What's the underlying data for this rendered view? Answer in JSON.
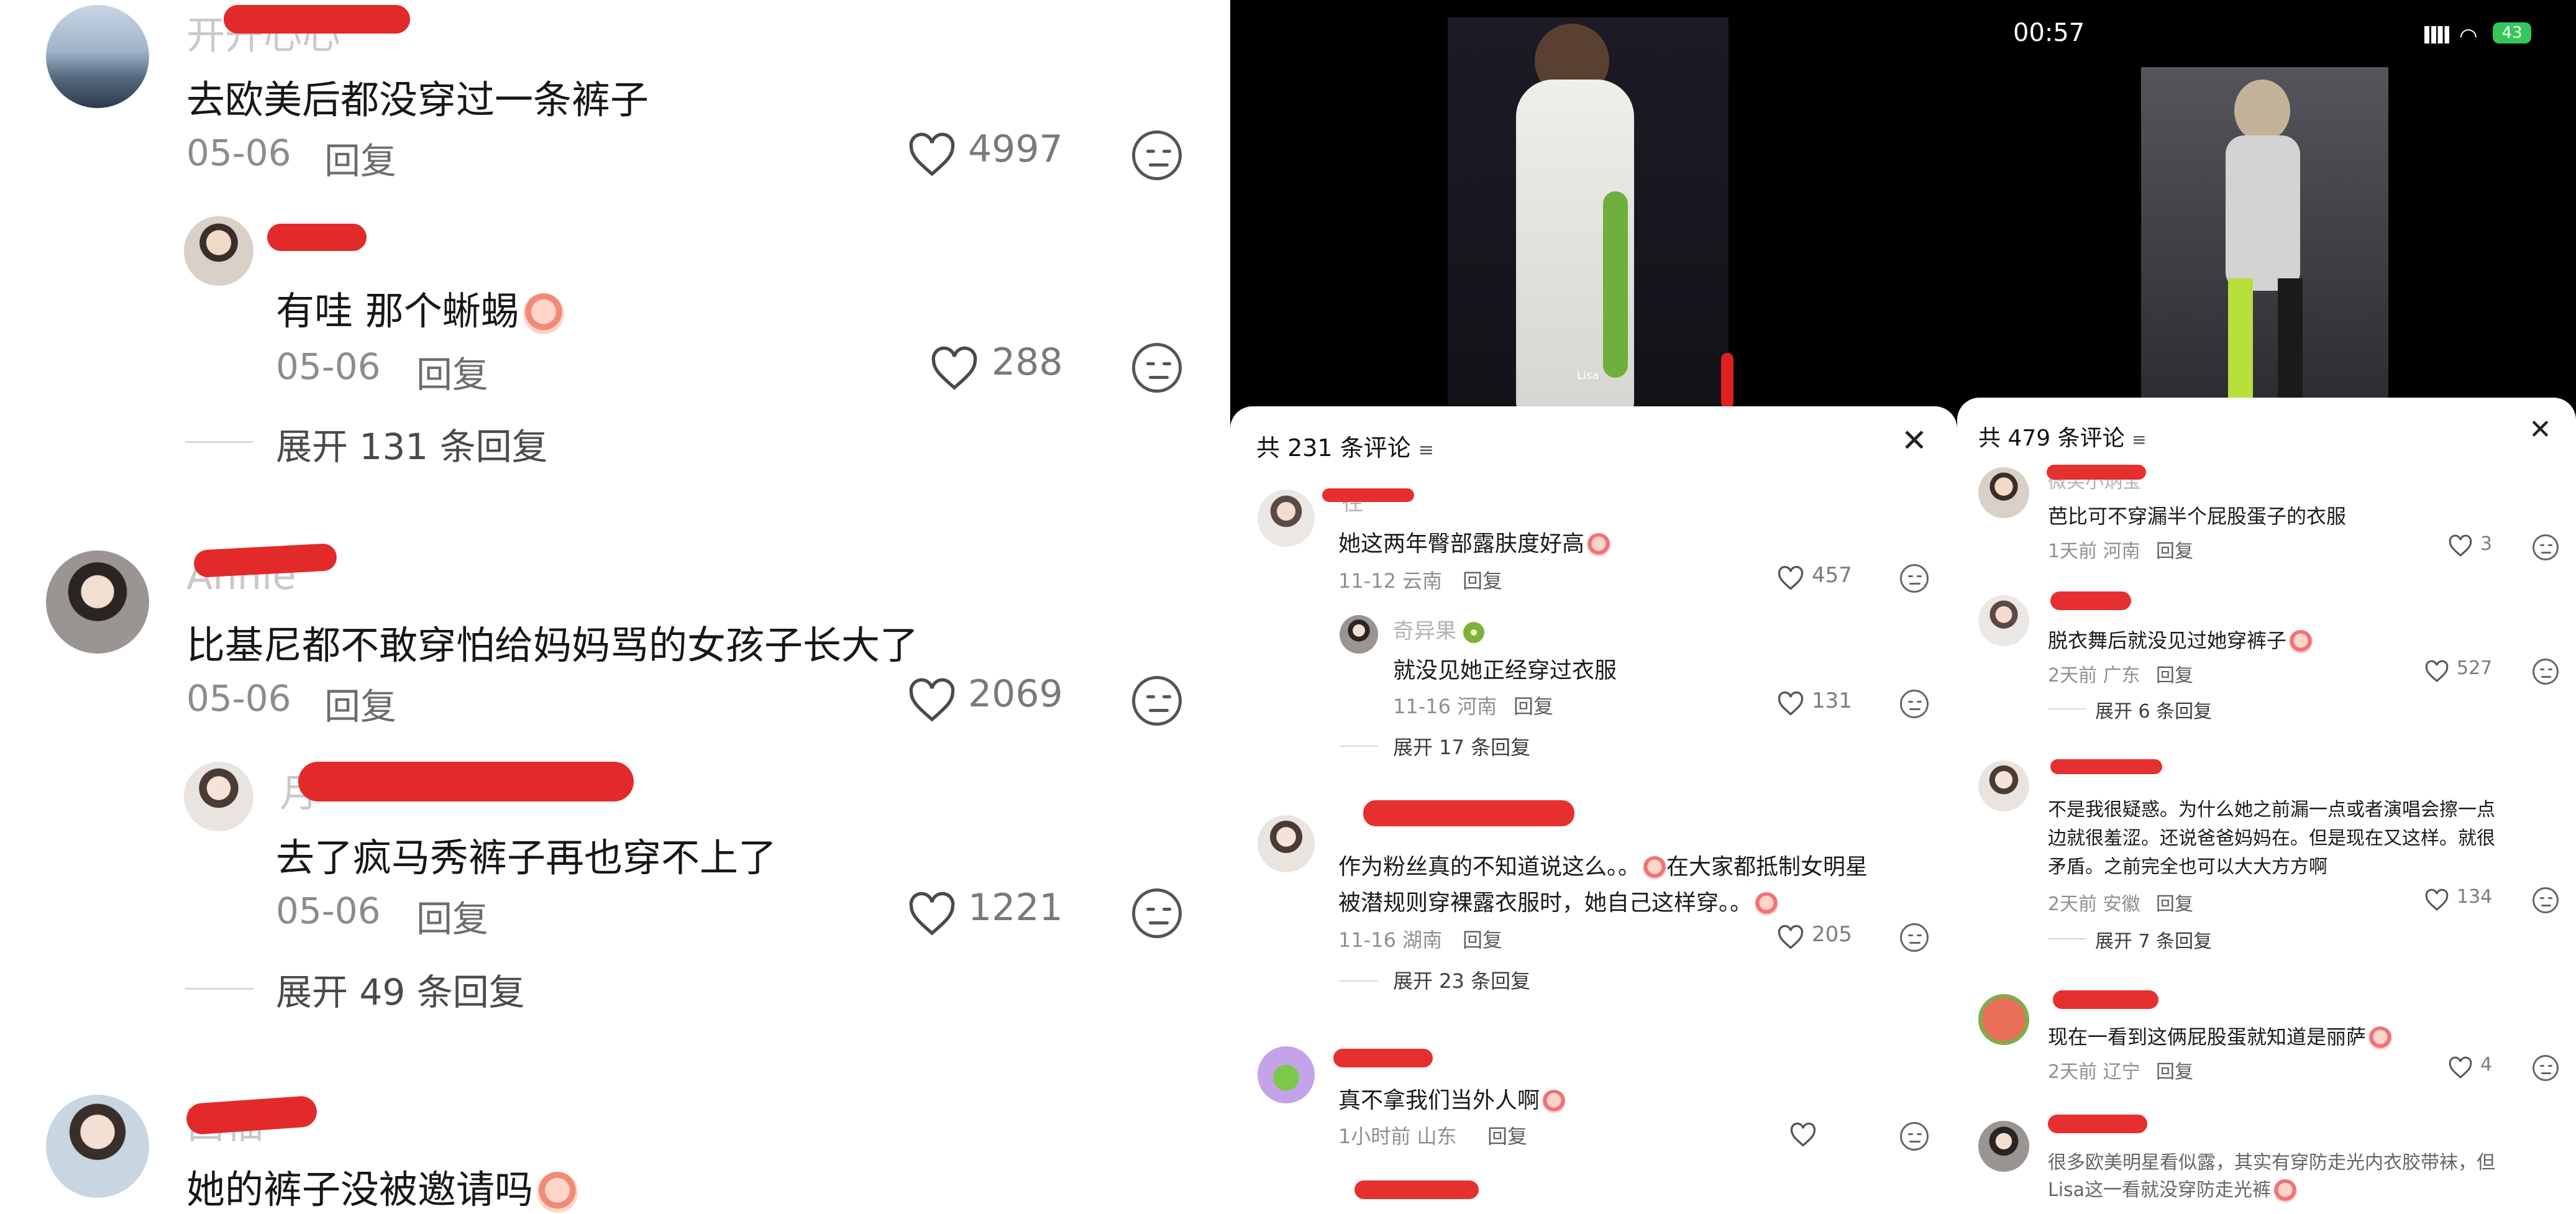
{
  "left": {
    "comments": [
      {
        "name": "开开心心",
        "text": "去欧美后都没穿过一条裤子",
        "date": "05-06",
        "reply": "回复",
        "likes": "4997",
        "replies": [
          {
            "name": "",
            "text": "有哇  那个蜥蜴",
            "date": "05-06",
            "reply": "回复",
            "likes": "288"
          }
        ],
        "expand": "展开 131 条回复"
      },
      {
        "name": "Annie",
        "text": "比基尼都不敢穿怕给妈妈骂的女孩子长大了",
        "date": "05-06",
        "reply": "回复",
        "likes": "2069",
        "replies": [
          {
            "name": "月",
            "text": "去了疯马秀裤子再也穿不上了",
            "date": "05-06",
            "reply": "回复",
            "likes": "1221"
          }
        ],
        "expand": "展开 49 条回复"
      },
      {
        "name": "西柚",
        "text": "她的裤子没被邀请吗",
        "date": "",
        "reply": "",
        "likes": ""
      }
    ]
  },
  "middle": {
    "video_caption": "Lisa",
    "sheet_title": "共 231 条评论",
    "close": "✕",
    "comments": [
      {
        "name": "往",
        "text": "她这两年臀部露肤度好高",
        "meta": "11-12 云南",
        "reply": "回复",
        "likes": "457"
      },
      {
        "name": "奇异果",
        "text": "就没见她正经穿过衣服",
        "meta": "11-16 河南",
        "reply": "回复",
        "likes": "131",
        "expand": "展开 17 条回复"
      },
      {
        "name": "",
        "text1": "作为粉丝真的不知道说这么。。",
        "text1b": "在大家都抵制女明星",
        "text2": "被潜规则穿裸露衣服时，她自己这样穿。。",
        "meta": "11-16 湖南",
        "reply": "回复",
        "likes": "205",
        "expand": "展开 23 条回复"
      },
      {
        "name": "",
        "text": "真不拿我们当外人啊",
        "meta": "1小时前 山东",
        "reply": "回复",
        "likes": ""
      }
    ]
  },
  "right": {
    "status_time": "00:57",
    "battery": "43",
    "sheet_title": "共 479 条评论",
    "close": "✕",
    "comments": [
      {
        "name": "微笑小炳宝",
        "text": "芭比可不穿漏半个屁股蛋子的衣服",
        "meta": "1天前 河南",
        "reply": "回复",
        "likes": "3"
      },
      {
        "name": "",
        "text": "脱衣舞后就没见过她穿裤子",
        "meta": "2天前 广东",
        "reply": "回复",
        "likes": "527",
        "expand": "展开 6 条回复"
      },
      {
        "name": "",
        "text1": "不是我很疑惑。为什么她之前漏一点或者演唱会擦一点",
        "text2": "边就很羞涩。还说爸爸妈妈在。但是现在又这样。就很",
        "text3": "矛盾。之前完全也可以大大方方啊",
        "meta": "2天前 安徽",
        "reply": "回复",
        "likes": "134",
        "expand": "展开 7 条回复"
      },
      {
        "name": "",
        "text": "现在一看到这俩屁股蛋就知道是丽萨",
        "meta": "2天前 辽宁",
        "reply": "回复",
        "likes": "4"
      },
      {
        "name": "",
        "text1": "很多欧美明星看似露，其实有穿防走光内衣胶带袜，但",
        "text2": "Lisa这一看就没穿防走光裤"
      }
    ]
  }
}
